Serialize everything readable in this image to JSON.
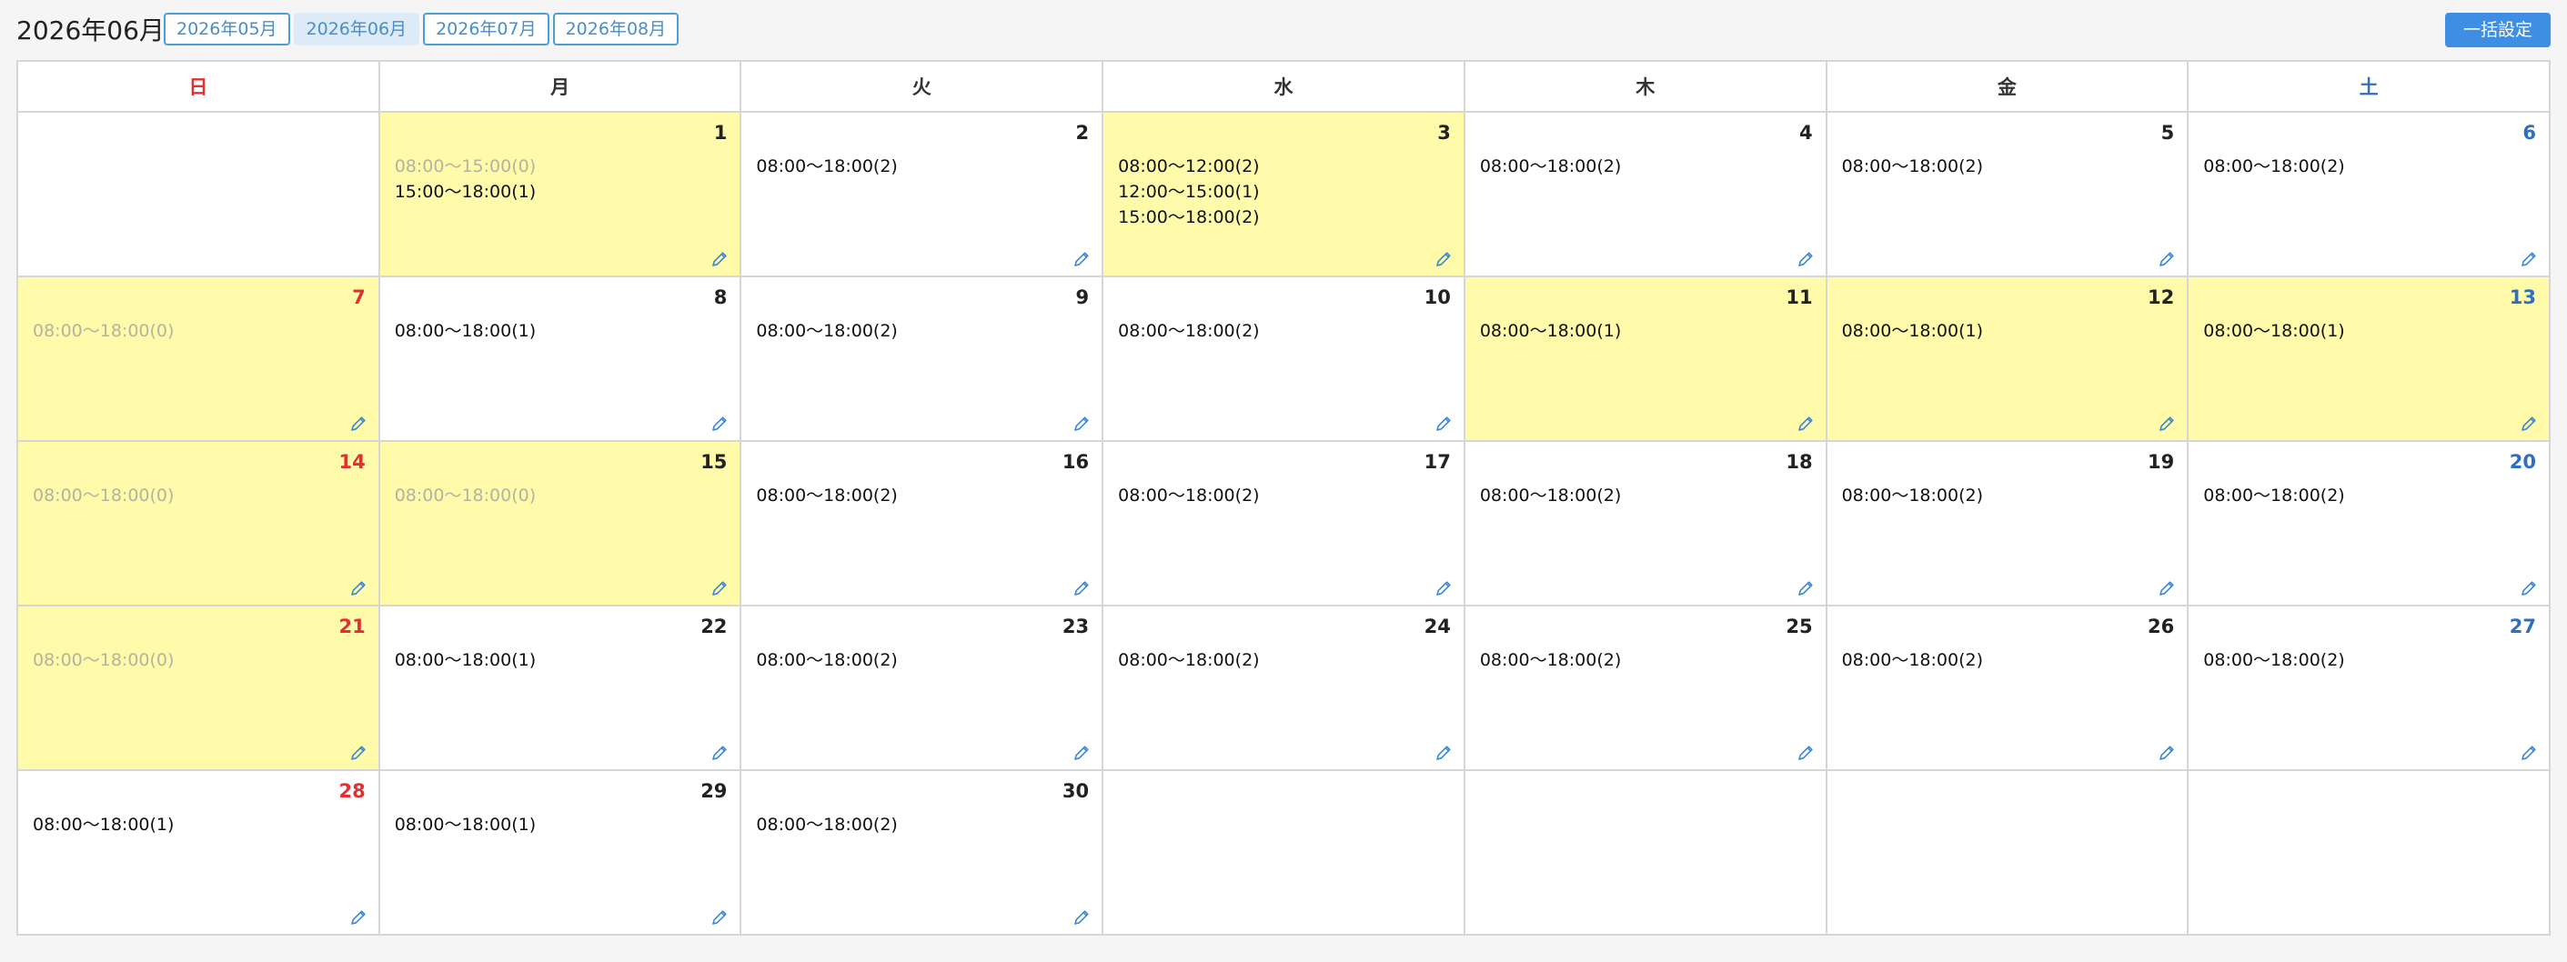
{
  "header": {
    "title": "2026年06月",
    "month_buttons": [
      {
        "label": "2026年05月",
        "active": false
      },
      {
        "label": "2026年06月",
        "active": true
      },
      {
        "label": "2026年07月",
        "active": false
      },
      {
        "label": "2026年08月",
        "active": false
      }
    ],
    "bulk_button": "一括設定"
  },
  "weekdays": [
    {
      "label": "日",
      "type": "sun"
    },
    {
      "label": "月",
      "type": "weekday"
    },
    {
      "label": "火",
      "type": "weekday"
    },
    {
      "label": "水",
      "type": "weekday"
    },
    {
      "label": "木",
      "type": "weekday"
    },
    {
      "label": "金",
      "type": "weekday"
    },
    {
      "label": "土",
      "type": "sat"
    }
  ],
  "colors": {
    "sunday": "#e03030",
    "saturday": "#2f6fbf",
    "highlight": "#fffbaa",
    "edit_icon": "#3a86d6"
  },
  "weeks": [
    [
      null,
      {
        "day": "1",
        "highlight": true,
        "slots": [
          {
            "text": "08:00〜15:00(0)",
            "muted": true
          },
          {
            "text": "15:00〜18:00(1)",
            "muted": false
          }
        ]
      },
      {
        "day": "2",
        "highlight": false,
        "slots": [
          {
            "text": "08:00〜18:00(2)",
            "muted": false
          }
        ]
      },
      {
        "day": "3",
        "highlight": true,
        "slots": [
          {
            "text": "08:00〜12:00(2)",
            "muted": false
          },
          {
            "text": "12:00〜15:00(1)",
            "muted": false
          },
          {
            "text": "15:00〜18:00(2)",
            "muted": false
          }
        ]
      },
      {
        "day": "4",
        "highlight": false,
        "slots": [
          {
            "text": "08:00〜18:00(2)",
            "muted": false
          }
        ]
      },
      {
        "day": "5",
        "highlight": false,
        "slots": [
          {
            "text": "08:00〜18:00(2)",
            "muted": false
          }
        ]
      },
      {
        "day": "6",
        "highlight": false,
        "slots": [
          {
            "text": "08:00〜18:00(2)",
            "muted": false
          }
        ]
      }
    ],
    [
      {
        "day": "7",
        "highlight": true,
        "slots": [
          {
            "text": "08:00〜18:00(0)",
            "muted": true
          }
        ]
      },
      {
        "day": "8",
        "highlight": false,
        "slots": [
          {
            "text": "08:00〜18:00(1)",
            "muted": false
          }
        ]
      },
      {
        "day": "9",
        "highlight": false,
        "slots": [
          {
            "text": "08:00〜18:00(2)",
            "muted": false
          }
        ]
      },
      {
        "day": "10",
        "highlight": false,
        "slots": [
          {
            "text": "08:00〜18:00(2)",
            "muted": false
          }
        ]
      },
      {
        "day": "11",
        "highlight": true,
        "slots": [
          {
            "text": "08:00〜18:00(1)",
            "muted": false
          }
        ]
      },
      {
        "day": "12",
        "highlight": true,
        "slots": [
          {
            "text": "08:00〜18:00(1)",
            "muted": false
          }
        ]
      },
      {
        "day": "13",
        "highlight": true,
        "slots": [
          {
            "text": "08:00〜18:00(1)",
            "muted": false
          }
        ]
      }
    ],
    [
      {
        "day": "14",
        "highlight": true,
        "slots": [
          {
            "text": "08:00〜18:00(0)",
            "muted": true
          }
        ]
      },
      {
        "day": "15",
        "highlight": true,
        "slots": [
          {
            "text": "08:00〜18:00(0)",
            "muted": true
          }
        ]
      },
      {
        "day": "16",
        "highlight": false,
        "slots": [
          {
            "text": "08:00〜18:00(2)",
            "muted": false
          }
        ]
      },
      {
        "day": "17",
        "highlight": false,
        "slots": [
          {
            "text": "08:00〜18:00(2)",
            "muted": false
          }
        ]
      },
      {
        "day": "18",
        "highlight": false,
        "slots": [
          {
            "text": "08:00〜18:00(2)",
            "muted": false
          }
        ]
      },
      {
        "day": "19",
        "highlight": false,
        "slots": [
          {
            "text": "08:00〜18:00(2)",
            "muted": false
          }
        ]
      },
      {
        "day": "20",
        "highlight": false,
        "slots": [
          {
            "text": "08:00〜18:00(2)",
            "muted": false
          }
        ]
      }
    ],
    [
      {
        "day": "21",
        "highlight": true,
        "slots": [
          {
            "text": "08:00〜18:00(0)",
            "muted": true
          }
        ]
      },
      {
        "day": "22",
        "highlight": false,
        "slots": [
          {
            "text": "08:00〜18:00(1)",
            "muted": false
          }
        ]
      },
      {
        "day": "23",
        "highlight": false,
        "slots": [
          {
            "text": "08:00〜18:00(2)",
            "muted": false
          }
        ]
      },
      {
        "day": "24",
        "highlight": false,
        "slots": [
          {
            "text": "08:00〜18:00(2)",
            "muted": false
          }
        ]
      },
      {
        "day": "25",
        "highlight": false,
        "slots": [
          {
            "text": "08:00〜18:00(2)",
            "muted": false
          }
        ]
      },
      {
        "day": "26",
        "highlight": false,
        "slots": [
          {
            "text": "08:00〜18:00(2)",
            "muted": false
          }
        ]
      },
      {
        "day": "27",
        "highlight": false,
        "slots": [
          {
            "text": "08:00〜18:00(2)",
            "muted": false
          }
        ]
      }
    ],
    [
      {
        "day": "28",
        "highlight": false,
        "slots": [
          {
            "text": "08:00〜18:00(1)",
            "muted": false
          }
        ]
      },
      {
        "day": "29",
        "highlight": false,
        "slots": [
          {
            "text": "08:00〜18:00(1)",
            "muted": false
          }
        ]
      },
      {
        "day": "30",
        "highlight": false,
        "slots": [
          {
            "text": "08:00〜18:00(2)",
            "muted": false
          }
        ]
      },
      null,
      null,
      null,
      null
    ]
  ]
}
